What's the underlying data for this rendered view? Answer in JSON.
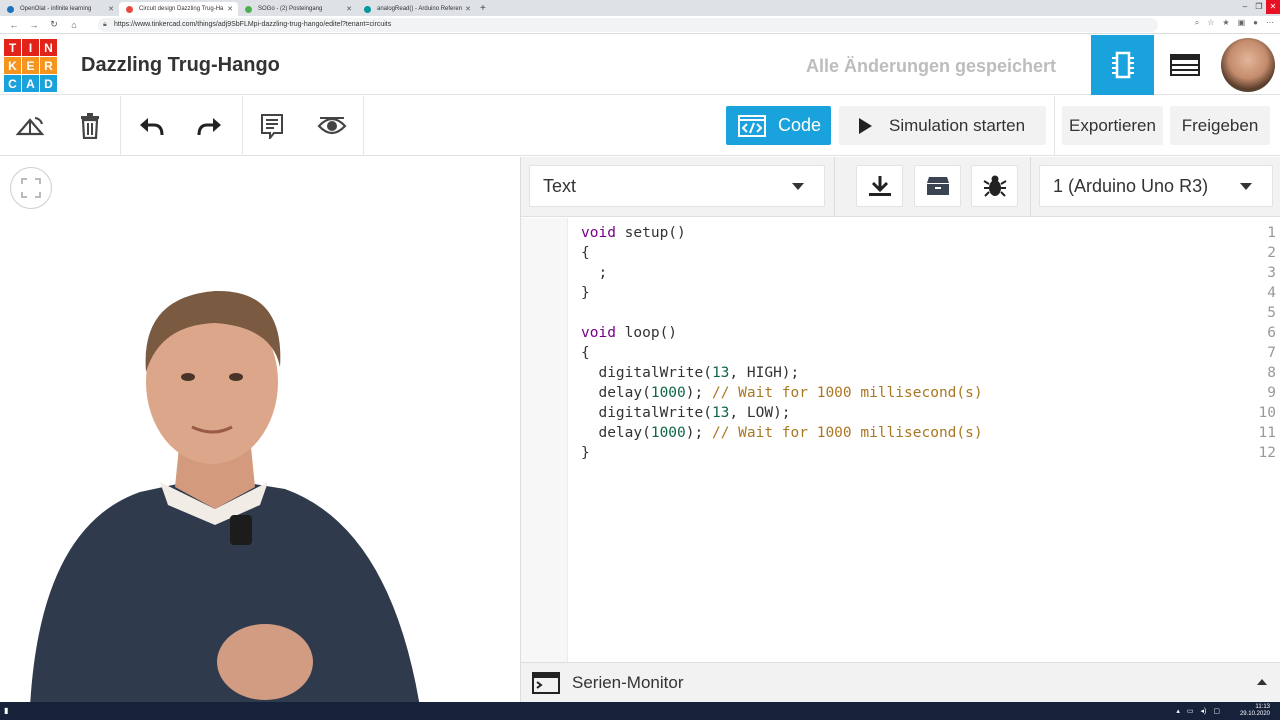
{
  "browser": {
    "tabs": [
      {
        "label": "OpenOlat - infinite learning",
        "color": "#1b72c1"
      },
      {
        "label": "Circuit design Dazzling Trug-Ha",
        "color": "#e84c3d"
      },
      {
        "label": "SOGo - (2) Posteingang",
        "color": "#4caf50"
      },
      {
        "label": "analogRead() - Arduino Referen",
        "color": "#00979c"
      }
    ],
    "url": "https://www.tinkercad.com/things/adj9SbFLMpi-dazzling-trug-hango/editel?tenant=circuits"
  },
  "header": {
    "logo_letters": [
      "T",
      "I",
      "N",
      "K",
      "E",
      "R",
      "C",
      "A",
      "D"
    ],
    "logo_colors": [
      "#e2231a",
      "#e2231a",
      "#e2231a",
      "#f7941d",
      "#f7941d",
      "#f7941d",
      "#1aa2dd",
      "#1aa2dd",
      "#1aa2dd"
    ],
    "project_title": "Dazzling Trug-Hango",
    "saved_status": "Alle Änderungen gespeichert"
  },
  "toolbar": {
    "code_label": "Code",
    "simulation_label": "Simulation starten",
    "export_label": "Exportieren",
    "share_label": "Freigeben"
  },
  "code_panel": {
    "mode": "Text",
    "board": "1 (Arduino Uno R3)",
    "serial_monitor_label": "Serien-Monitor"
  },
  "code_lines": [
    {
      "n": "1",
      "tokens": [
        [
          "kw",
          "void"
        ],
        [
          "nm",
          " setup()"
        ]
      ]
    },
    {
      "n": "2",
      "tokens": [
        [
          "nm",
          "{"
        ]
      ]
    },
    {
      "n": "3",
      "tokens": [
        [
          "nm",
          "  ;"
        ]
      ]
    },
    {
      "n": "4",
      "tokens": [
        [
          "nm",
          "}"
        ]
      ]
    },
    {
      "n": "5",
      "tokens": []
    },
    {
      "n": "6",
      "tokens": [
        [
          "kw",
          "void"
        ],
        [
          "nm",
          " loop()"
        ]
      ]
    },
    {
      "n": "7",
      "tokens": [
        [
          "nm",
          "{"
        ]
      ]
    },
    {
      "n": "8",
      "tokens": [
        [
          "nm",
          "  digitalWrite("
        ],
        [
          "num",
          "13"
        ],
        [
          "nm",
          ", HIGH);"
        ]
      ]
    },
    {
      "n": "9",
      "tokens": [
        [
          "nm",
          "  delay("
        ],
        [
          "num",
          "1000"
        ],
        [
          "nm",
          "); "
        ],
        [
          "com",
          "// Wait for 1000 millisecond(s)"
        ]
      ]
    },
    {
      "n": "10",
      "tokens": [
        [
          "nm",
          "  digitalWrite("
        ],
        [
          "num",
          "13"
        ],
        [
          "nm",
          ", LOW);"
        ]
      ]
    },
    {
      "n": "11",
      "tokens": [
        [
          "nm",
          "  delay("
        ],
        [
          "num",
          "1000"
        ],
        [
          "nm",
          "); "
        ],
        [
          "com",
          "// Wait for 1000 millisecond(s)"
        ]
      ]
    },
    {
      "n": "12",
      "tokens": [
        [
          "nm",
          "}"
        ]
      ]
    }
  ],
  "taskbar": {
    "time": "11:13",
    "date": "29.10.2020"
  }
}
